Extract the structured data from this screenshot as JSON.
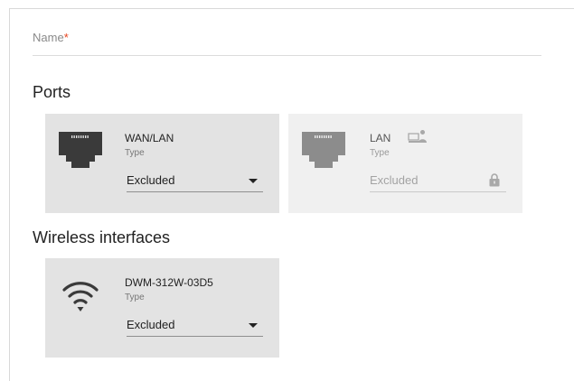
{
  "form": {
    "name_label": "Name",
    "required_mark": "*"
  },
  "sections": {
    "ports_title": "Ports",
    "wireless_title": "Wireless interfaces"
  },
  "ports": [
    {
      "name": "WAN/LAN",
      "type_label": "Type",
      "type_value": "Excluded",
      "disabled": false
    },
    {
      "name": "LAN",
      "type_label": "Type",
      "type_value": "Excluded",
      "disabled": true
    }
  ],
  "wireless": [
    {
      "name": "DWM-312W-03D5",
      "type_label": "Type",
      "type_value": "Excluded"
    }
  ],
  "colors": {
    "card_bg": "#e3e3e3",
    "card_disabled_bg": "#f0f0f0",
    "required": "#e8431e",
    "icon_dark": "#3a3a3a",
    "icon_disabled": "#8c8c8c"
  },
  "icons": [
    "ethernet-port-icon",
    "network-computer-icon",
    "lock-icon",
    "wifi-icon",
    "chevron-down-icon"
  ]
}
